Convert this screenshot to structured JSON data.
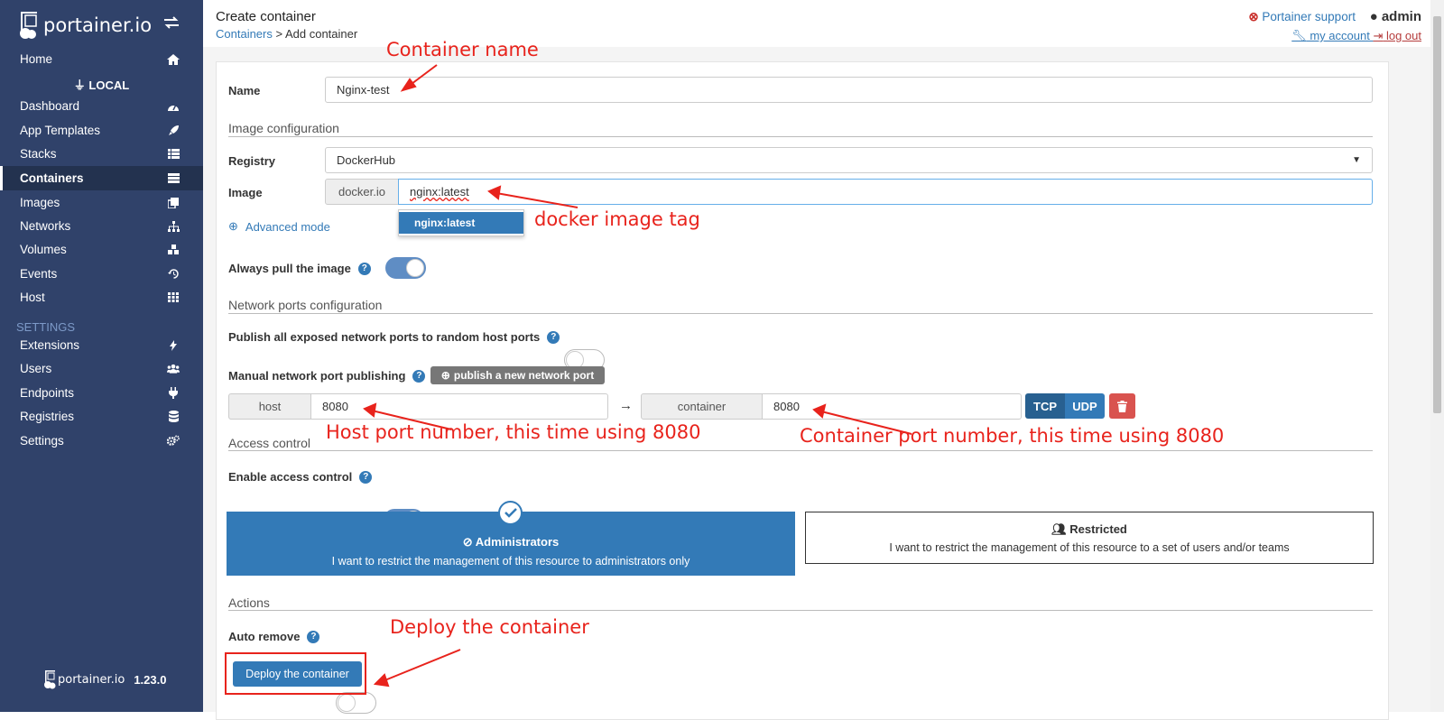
{
  "sidebar": {
    "logo_text": "portainer.io",
    "home": "Home",
    "env": "LOCAL",
    "items": [
      {
        "label": "Dashboard"
      },
      {
        "label": "App Templates"
      },
      {
        "label": "Stacks"
      },
      {
        "label": "Containers"
      },
      {
        "label": "Images"
      },
      {
        "label": "Networks"
      },
      {
        "label": "Volumes"
      },
      {
        "label": "Events"
      },
      {
        "label": "Host"
      }
    ],
    "settings_header": "SETTINGS",
    "settings_items": [
      {
        "label": "Extensions"
      },
      {
        "label": "Users"
      },
      {
        "label": "Endpoints"
      },
      {
        "label": "Registries"
      },
      {
        "label": "Settings"
      }
    ],
    "footer_logo": "portainer.io",
    "version": "1.23.0"
  },
  "header": {
    "title": "Create container",
    "crumb_link": "Containers",
    "crumb_rest": " > Add container",
    "support": "Portainer support",
    "user": "admin",
    "my_account": " my account ",
    "logout": " log out"
  },
  "form": {
    "name_label": "Name",
    "name_value": "Nginx-test",
    "image_section": "Image configuration",
    "registry_label": "Registry",
    "registry_value": "DockerHub",
    "image_label": "Image",
    "image_prefix": "docker.io",
    "image_value": "nginx:latest",
    "suggestion": "nginx:latest",
    "advanced_mode": "Advanced mode",
    "always_pull_label": "Always pull the image",
    "always_pull_on": true,
    "network_section": "Network ports configuration",
    "publish_all_label": "Publish all exposed network ports to random host ports",
    "publish_all_on": false,
    "manual_label": "Manual network port publishing",
    "publish_btn": "publish a new network port",
    "host_addon": "host",
    "host_port": "8080",
    "arrow": "→",
    "container_addon": "container",
    "container_port": "8080",
    "tcp": "TCP",
    "udp": "UDP",
    "access_section": "Access control",
    "enable_access_label": "Enable access control",
    "enable_access_on": true,
    "admin_title": "Administrators",
    "admin_desc": "I want to restrict the management of this resource to administrators only",
    "restricted_title": "Restricted",
    "restricted_desc": "I want to restrict the management of this resource to a set of users and/or teams",
    "actions_section": "Actions",
    "auto_remove_label": "Auto remove",
    "auto_remove_on": false,
    "deploy_btn": "Deploy the container"
  },
  "annotations": {
    "container_name": "Container name",
    "image_tag": "docker image tag",
    "host_port": "Host port number, this time using 8080",
    "container_port": "Container port number, this time using 8080",
    "deploy": "Deploy the container"
  },
  "colors": {
    "sidebar_bg": "#30426a",
    "primary": "#337ab7",
    "annotation": "#e8231c",
    "danger": "#d9534f",
    "tcp_active": "#286090"
  }
}
